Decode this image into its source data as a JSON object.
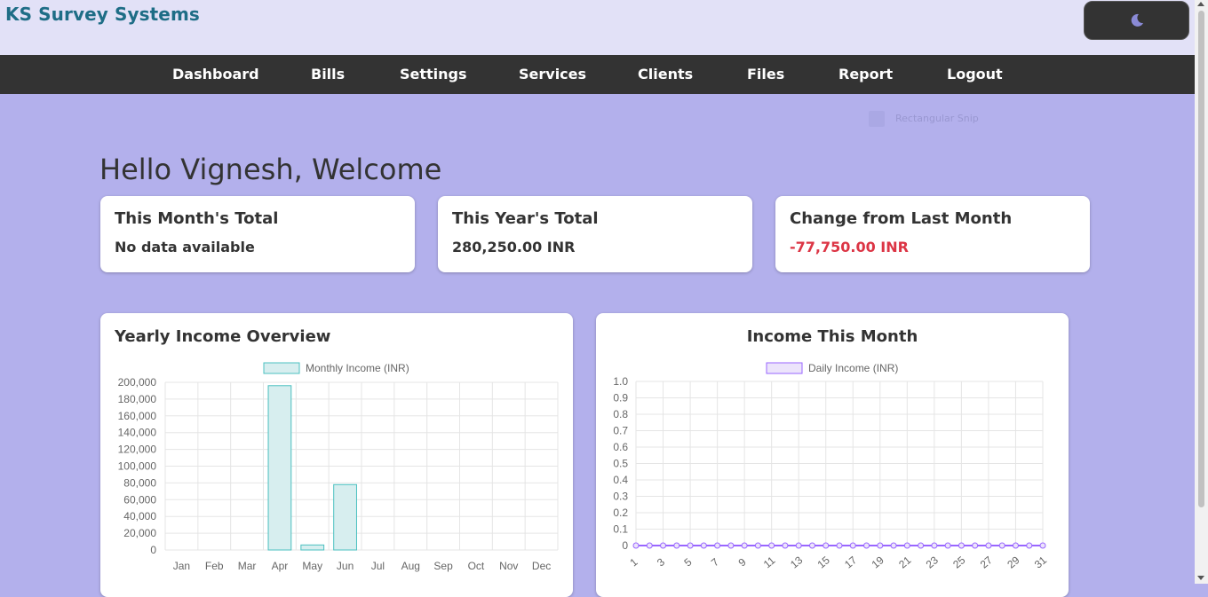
{
  "header": {
    "brand": "KS Survey Systems",
    "theme_toggle_icon": "moon-icon"
  },
  "nav": {
    "items": [
      "Dashboard",
      "Bills",
      "Settings",
      "Services",
      "Clients",
      "Files",
      "Report",
      "Logout"
    ]
  },
  "overlay": {
    "label": "Rectangular Snip"
  },
  "welcome": "Hello Vignesh, Welcome",
  "cards": [
    {
      "title": "This Month's Total",
      "value": "No data available"
    },
    {
      "title": "This Year's Total",
      "value": "280,250.00 INR"
    },
    {
      "title": "Change from Last Month",
      "value": "-77,750.00 INR",
      "negative": true
    }
  ],
  "colors": {
    "brand": "#1e6d86",
    "negative": "#dc3545",
    "bar_fill": "#d7eeef",
    "bar_stroke": "#4bc0c0",
    "line_fill": "#ece4fb",
    "line_stroke": "#9966ff"
  },
  "chart_data": [
    {
      "type": "bar",
      "title": "Yearly Income Overview",
      "categories": [
        "Jan",
        "Feb",
        "Mar",
        "Apr",
        "May",
        "Jun",
        "Jul",
        "Aug",
        "Sep",
        "Oct",
        "Nov",
        "Dec"
      ],
      "series": [
        {
          "name": "Monthly Income (INR)",
          "values": [
            0,
            0,
            0,
            196000,
            6000,
            78000,
            0,
            0,
            0,
            0,
            0,
            0
          ]
        }
      ],
      "ylim": [
        0,
        200000
      ],
      "yticks": [
        "200,000",
        "180,000",
        "160,000",
        "140,000",
        "120,000",
        "100,000",
        "80,000",
        "60,000",
        "40,000",
        "20,000",
        "0"
      ],
      "grid": true,
      "legend": "top-center"
    },
    {
      "type": "line",
      "title": "Income This Month",
      "x": [
        1,
        2,
        3,
        4,
        5,
        6,
        7,
        8,
        9,
        10,
        11,
        12,
        13,
        14,
        15,
        16,
        17,
        18,
        19,
        20,
        21,
        22,
        23,
        24,
        25,
        26,
        27,
        28,
        29,
        30,
        31
      ],
      "xtick_labels": [
        "1",
        "3",
        "5",
        "7",
        "9",
        "11",
        "13",
        "15",
        "17",
        "19",
        "21",
        "23",
        "25",
        "27",
        "29",
        "31"
      ],
      "series": [
        {
          "name": "Daily Income (INR)",
          "values": [
            0,
            0,
            0,
            0,
            0,
            0,
            0,
            0,
            0,
            0,
            0,
            0,
            0,
            0,
            0,
            0,
            0,
            0,
            0,
            0,
            0,
            0,
            0,
            0,
            0,
            0,
            0,
            0,
            0,
            0,
            0
          ]
        }
      ],
      "ylim": [
        0,
        1
      ],
      "yticks": [
        "1.0",
        "0.9",
        "0.8",
        "0.7",
        "0.6",
        "0.5",
        "0.4",
        "0.3",
        "0.2",
        "0.1",
        "0"
      ],
      "grid": true,
      "legend": "top-center"
    }
  ]
}
